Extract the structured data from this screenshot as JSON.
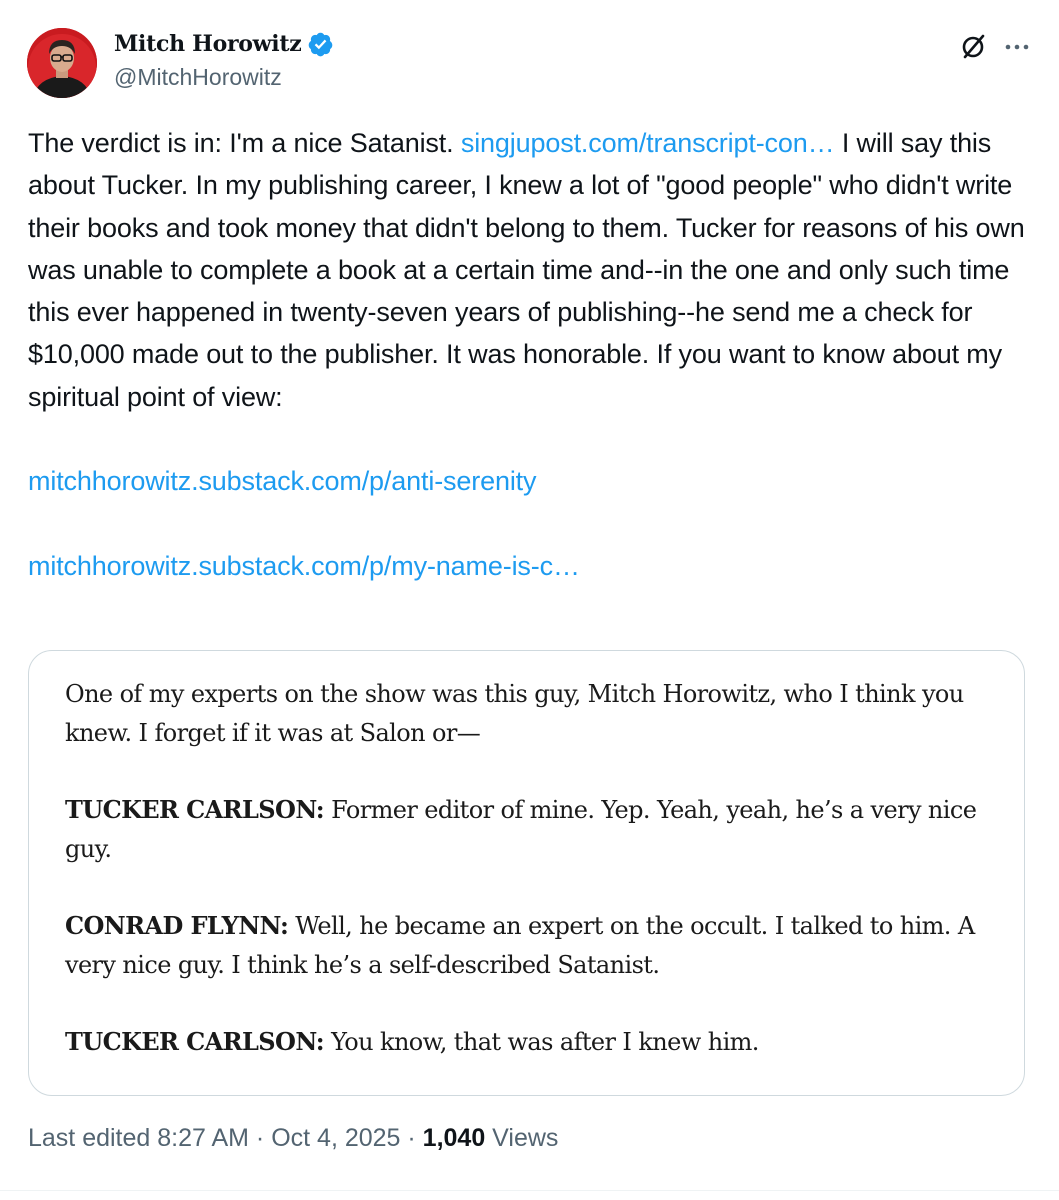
{
  "author": {
    "display_name": "Mitch Horowitz",
    "handle": "@MitchHorowitz",
    "verified": true
  },
  "header_icons": {
    "grok_icon": "grok-icon",
    "more_icon": "more-horizontal-icon",
    "more_label": "···"
  },
  "tweet": {
    "p1": {
      "lead": "The verdict is in: I'm a nice Satanist. ",
      "link1": "singjupost.com/transcript-con…",
      "rest": " I will say this about Tucker. In my publishing career, I knew a lot of \"good people\" who didn't write their books and took money that didn't belong to them. Tucker for reasons of his own was unable to complete a book at a certain time and--in the one and only such time this ever happened in twenty-seven years of publishing--he send me a check for $10,000 made out to the publisher. It was honorable. If you want to know about my spiritual point of view:"
    },
    "link2": "mitchhorowitz.substack.com/p/anti-serenity",
    "link3": "mitchhorowitz.substack.com/p/my-name-is-c…"
  },
  "quote_image": {
    "para1": "One of my experts on the show was this guy, Mitch Horowitz, who I think you knew. I forget if it was at Salon or—",
    "para2_speaker": "TUCKER CARLSON:",
    "para2_text": " Former editor of mine. Yep. Yeah, yeah, he’s a very nice guy.",
    "para3_speaker": "CONRAD FLYNN:",
    "para3_text": " Well, he became an expert on the occult. I talked to him. A very nice guy. I think he’s a self-described Satanist.",
    "para4_speaker": "TUCKER CARLSON:",
    "para4_text": " You know, that was after I knew him."
  },
  "meta": {
    "edited": "Last edited 8:27 AM · Oct 4, 2025 · ",
    "views_count": "1,040",
    "views_label": " Views"
  },
  "colors": {
    "link": "#1d9bf0",
    "secondary_text": "#536471",
    "primary_text": "#0f1419",
    "verified_badge": "#1d9bf0",
    "border": "#cfd9de"
  }
}
